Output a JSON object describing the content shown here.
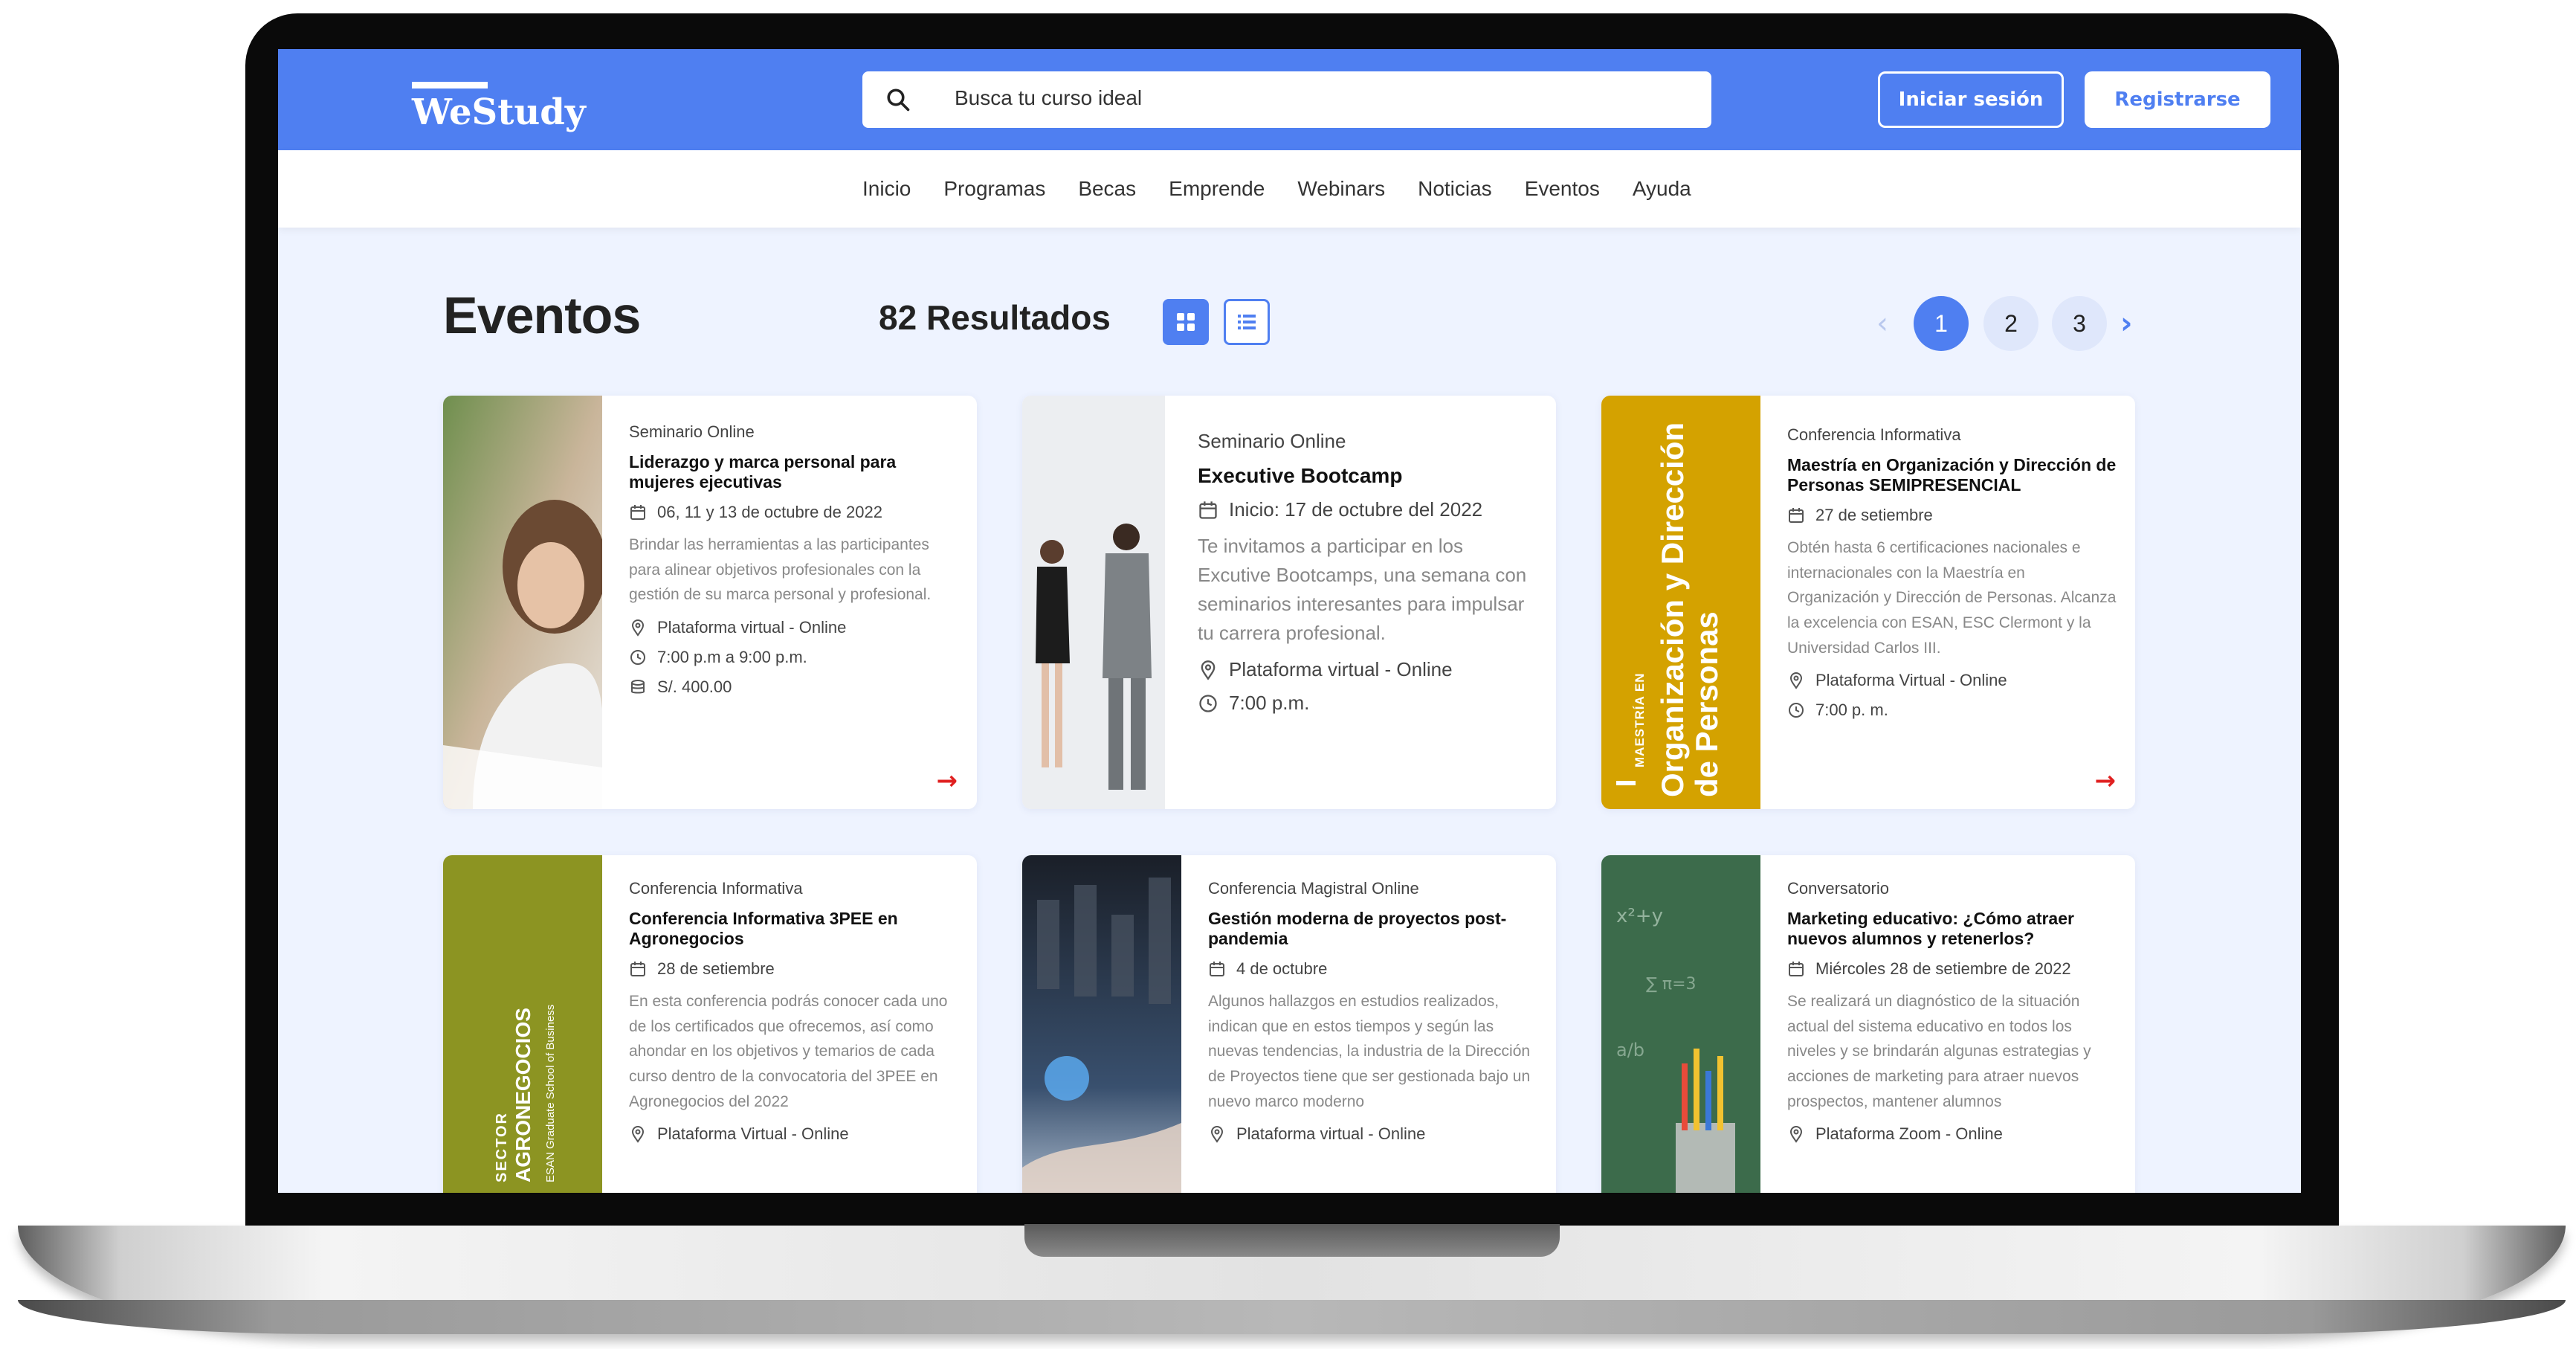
{
  "brand": {
    "name": "WeStudy"
  },
  "header": {
    "search_placeholder": "Busca tu curso ideal",
    "login_label": "Iniciar sesión",
    "register_label": "Registrarse"
  },
  "nav": [
    "Inicio",
    "Programas",
    "Becas",
    "Emprende",
    "Webinars",
    "Noticias",
    "Eventos",
    "Ayuda"
  ],
  "page": {
    "title": "Eventos",
    "results": "82 Resultados"
  },
  "pagination": {
    "pages": [
      "1",
      "2",
      "3"
    ],
    "current": "1"
  },
  "colors": {
    "primary": "#4f7ff1",
    "arrow": "#e02020"
  },
  "cards": [
    {
      "type": "Seminario Online",
      "title": "Liderazgo y marca personal para mujeres ejecutivas",
      "date": "06, 11 y 13 de octubre de 2022",
      "desc": "Brindar las herramientas a las participantes para alinear objetivos profesionales con la gestión de su marca personal y profesional.",
      "place": "Plataforma virtual - Online",
      "time": "7:00 p.m a 9:00 p.m.",
      "price": "S/. 400.00"
    },
    {
      "type": "Seminario Online",
      "title": "Executive Bootcamp",
      "date": "Inicio: 17 de octubre del 2022",
      "desc": "Te invitamos a participar en los Excutive Bootcamps, una semana con seminarios interesantes para impulsar tu carrera profesional.",
      "place": "Plataforma virtual - Online",
      "time": "7:00 p.m."
    },
    {
      "type": "Conferencia Informativa",
      "title": "Maestría en Organización y Dirección de Personas SEMIPRESENCIAL",
      "date": "27 de setiembre",
      "desc": "Obtén hasta 6 certificaciones nacionales e internacionales con la Maestría en Organización y Dirección de Personas. Alcanza la excelencia con ESAN, ESC Clermont y la Universidad Carlos III.",
      "place": "Plataforma Virtual - Online",
      "time": "7:00 p. m.",
      "image_text_small": "MAESTRÍA EN",
      "image_text_big1": "Organización y Dirección",
      "image_text_big2": "de Personas"
    },
    {
      "type": "Conferencia Informativa",
      "title": "Conferencia Informativa 3PEE en Agronegocios",
      "date": "28 de setiembre",
      "desc": "En esta conferencia podrás conocer cada uno de los certificados que ofrecemos, así como ahondar en los objetivos y temarios de cada curso dentro de la convocatoria del 3PEE en Agronegocios del 2022",
      "place": "Plataforma Virtual - Online",
      "image_text_small": "SECTOR",
      "image_text_big": "AGRONEGOCIOS",
      "image_text_sub": "ESAN Graduate School of Business"
    },
    {
      "type": "Conferencia Magistral Online",
      "title": "Gestión moderna de proyectos post-pandemia",
      "date": "4 de octubre",
      "desc": "Algunos hallazgos en estudios realizados, indican que en estos tiempos y según las nuevas tendencias, la industria de la Dirección de Proyectos tiene que ser gestionada bajo un nuevo marco moderno",
      "place": "Plataforma virtual - Online"
    },
    {
      "type": "Conversatorio",
      "title": "Marketing educativo: ¿Cómo atraer nuevos alumnos y retenerlos?",
      "date": "Miércoles 28 de setiembre de 2022",
      "desc": "Se realizará un diagnóstico de la situación actual del sistema educativo en todos los niveles y se brindarán algunas estrategias y acciones de marketing para atraer nuevos prospectos, mantener alumnos",
      "place": "Plataforma Zoom - Online"
    }
  ]
}
